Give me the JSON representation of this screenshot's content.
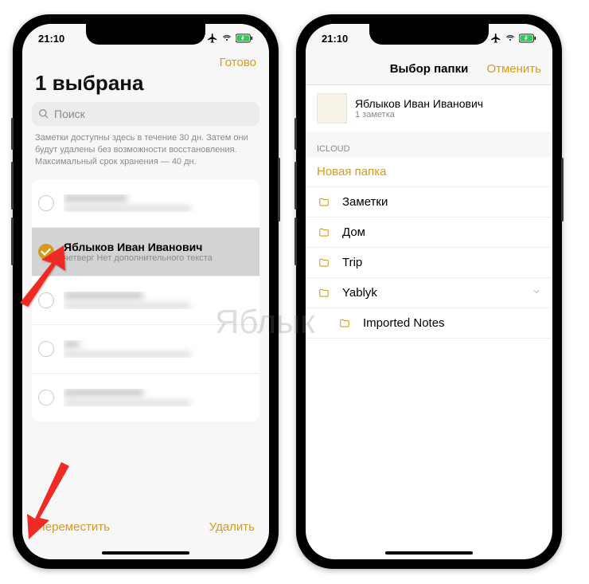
{
  "status": {
    "time": "21:10"
  },
  "colors": {
    "accent": "#d49b1f"
  },
  "left": {
    "done": "Готово",
    "title": "1 выбрана",
    "search_placeholder": "Поиск",
    "info": "Заметки доступны здесь в течение 30 дн. Затем они будут удалены без возможности восстановления. Максимальный срок хранения — 40 дн.",
    "selected_note": {
      "title": "Яблыков Иван Иванович",
      "subtitle": "четверг  Нет дополнительного текста"
    },
    "move": "Переместить",
    "delete": "Удалить"
  },
  "right": {
    "navtitle": "Выбор папки",
    "cancel": "Отменить",
    "note_title": "Яблыков Иван Иванович",
    "note_count": "1 заметка",
    "section": "ICLOUD",
    "new_folder": "Новая папка",
    "folders": [
      {
        "label": "Заметки"
      },
      {
        "label": "Дом"
      },
      {
        "label": "Trip"
      },
      {
        "label": "Yablyk",
        "expandable": true
      },
      {
        "label": "Imported Notes"
      }
    ]
  },
  "watermark": "Яблык"
}
